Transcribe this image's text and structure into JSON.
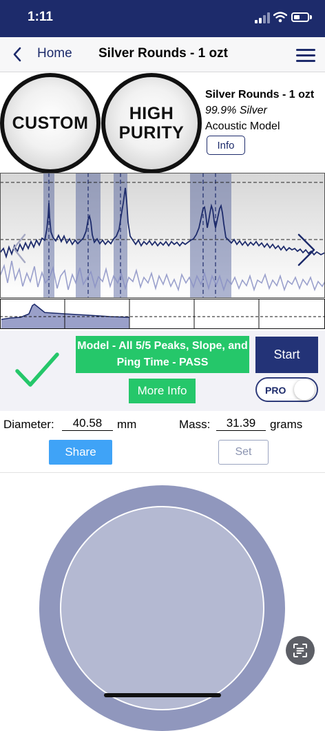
{
  "status_bar": {
    "time": "1:11"
  },
  "nav": {
    "back_label": "Home",
    "title": "Silver Rounds - 1 ozt"
  },
  "badges": {
    "custom": [
      "CUSTOM"
    ],
    "purity": [
      "HIGH",
      "PURITY"
    ]
  },
  "model": {
    "name": "Silver Rounds - 1 ozt",
    "purity": "99.9% Silver",
    "type": "Acoustic Model",
    "info_label": "Info"
  },
  "result": {
    "banner": "Model - All 5/5 Peaks, Slope, and Ping Time - PASS",
    "more_info_label": "More Info",
    "start_label": "Start",
    "pro_label": "PRO",
    "pro_enabled": false,
    "status": "pass"
  },
  "measurements": {
    "diameter_label": "Diameter:",
    "diameter_value": "40.58",
    "diameter_unit": "mm",
    "mass_label": "Mass:",
    "mass_value": "31.39",
    "mass_unit": "grams"
  },
  "actions": {
    "share_label": "Share",
    "set_label": "Set"
  },
  "icons": {
    "back": "chevron-left-icon",
    "menu": "hamburger-menu-icon",
    "check": "checkmark-icon",
    "scan": "text-scan-icon",
    "graph_prev": "chevron-left-icon",
    "graph_next": "chevron-right-icon"
  },
  "colors": {
    "header": "#1d2b6b",
    "pass_green": "#25c76a",
    "start_button": "#233377",
    "share_button": "#3fa3f7",
    "coin_outer": "#9097bd",
    "coin_inner": "#b4b9d2"
  }
}
